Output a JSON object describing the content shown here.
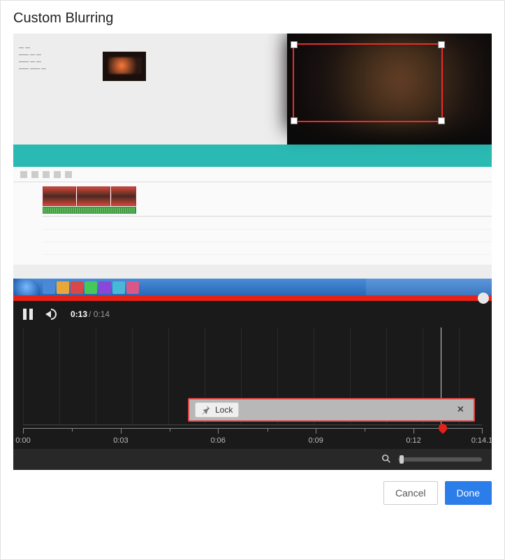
{
  "header": {
    "title": "Custom Blurring"
  },
  "player": {
    "current_time": "0:13",
    "total_time": "0:14"
  },
  "lock_region": {
    "label": "Lock"
  },
  "ruler": {
    "labels": [
      "0:00",
      "0:03",
      "0:06",
      "0:09",
      "0:12",
      "0:14.1"
    ]
  },
  "footer": {
    "cancel": "Cancel",
    "done": "Done"
  }
}
